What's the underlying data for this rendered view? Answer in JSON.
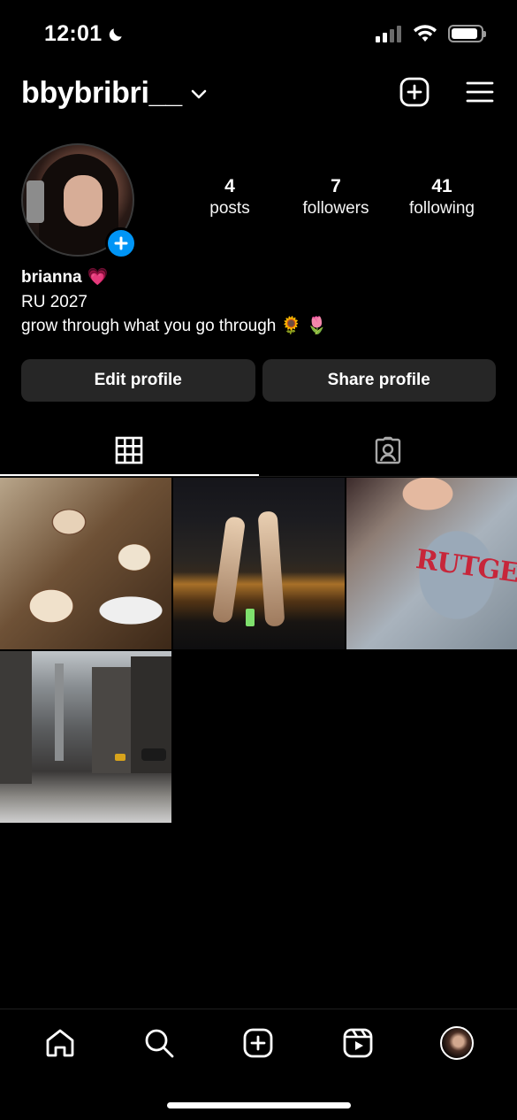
{
  "status_bar": {
    "time": "12:01",
    "icons": [
      "moon-icon",
      "signal-icon",
      "wifi-icon",
      "battery-icon"
    ]
  },
  "header": {
    "username": "bbybribri__",
    "icons": [
      "chevron-down-icon",
      "create-post-icon",
      "menu-icon"
    ]
  },
  "profile": {
    "stats": [
      {
        "number": "4",
        "label": "posts"
      },
      {
        "number": "7",
        "label": "followers"
      },
      {
        "number": "41",
        "label": "following"
      }
    ],
    "name": "brianna",
    "name_emoji": "💗",
    "bio_lines": [
      "RU 2027",
      "grow through what you go through 🌻 🌷"
    ]
  },
  "buttons": {
    "edit": "Edit profile",
    "share": "Share profile"
  },
  "tabs": {
    "items": [
      "grid-icon",
      "tagged-icon"
    ],
    "active": "grid-icon"
  },
  "posts_grid": {
    "tiles": [
      "latte-art-coffee-cups",
      "car-night-sunroof-hands",
      "rutgers-sweatshirt-selfie",
      "rainy-city-street"
    ],
    "rutgers_text": "RUTGERS"
  },
  "bottom_nav": {
    "items": [
      "home-icon",
      "search-icon",
      "create-icon",
      "reels-icon",
      "profile-avatar"
    ],
    "active": "profile-avatar"
  },
  "colors": {
    "background": "#000000",
    "button_bg": "#262626",
    "accent_blue": "#0095f6"
  }
}
